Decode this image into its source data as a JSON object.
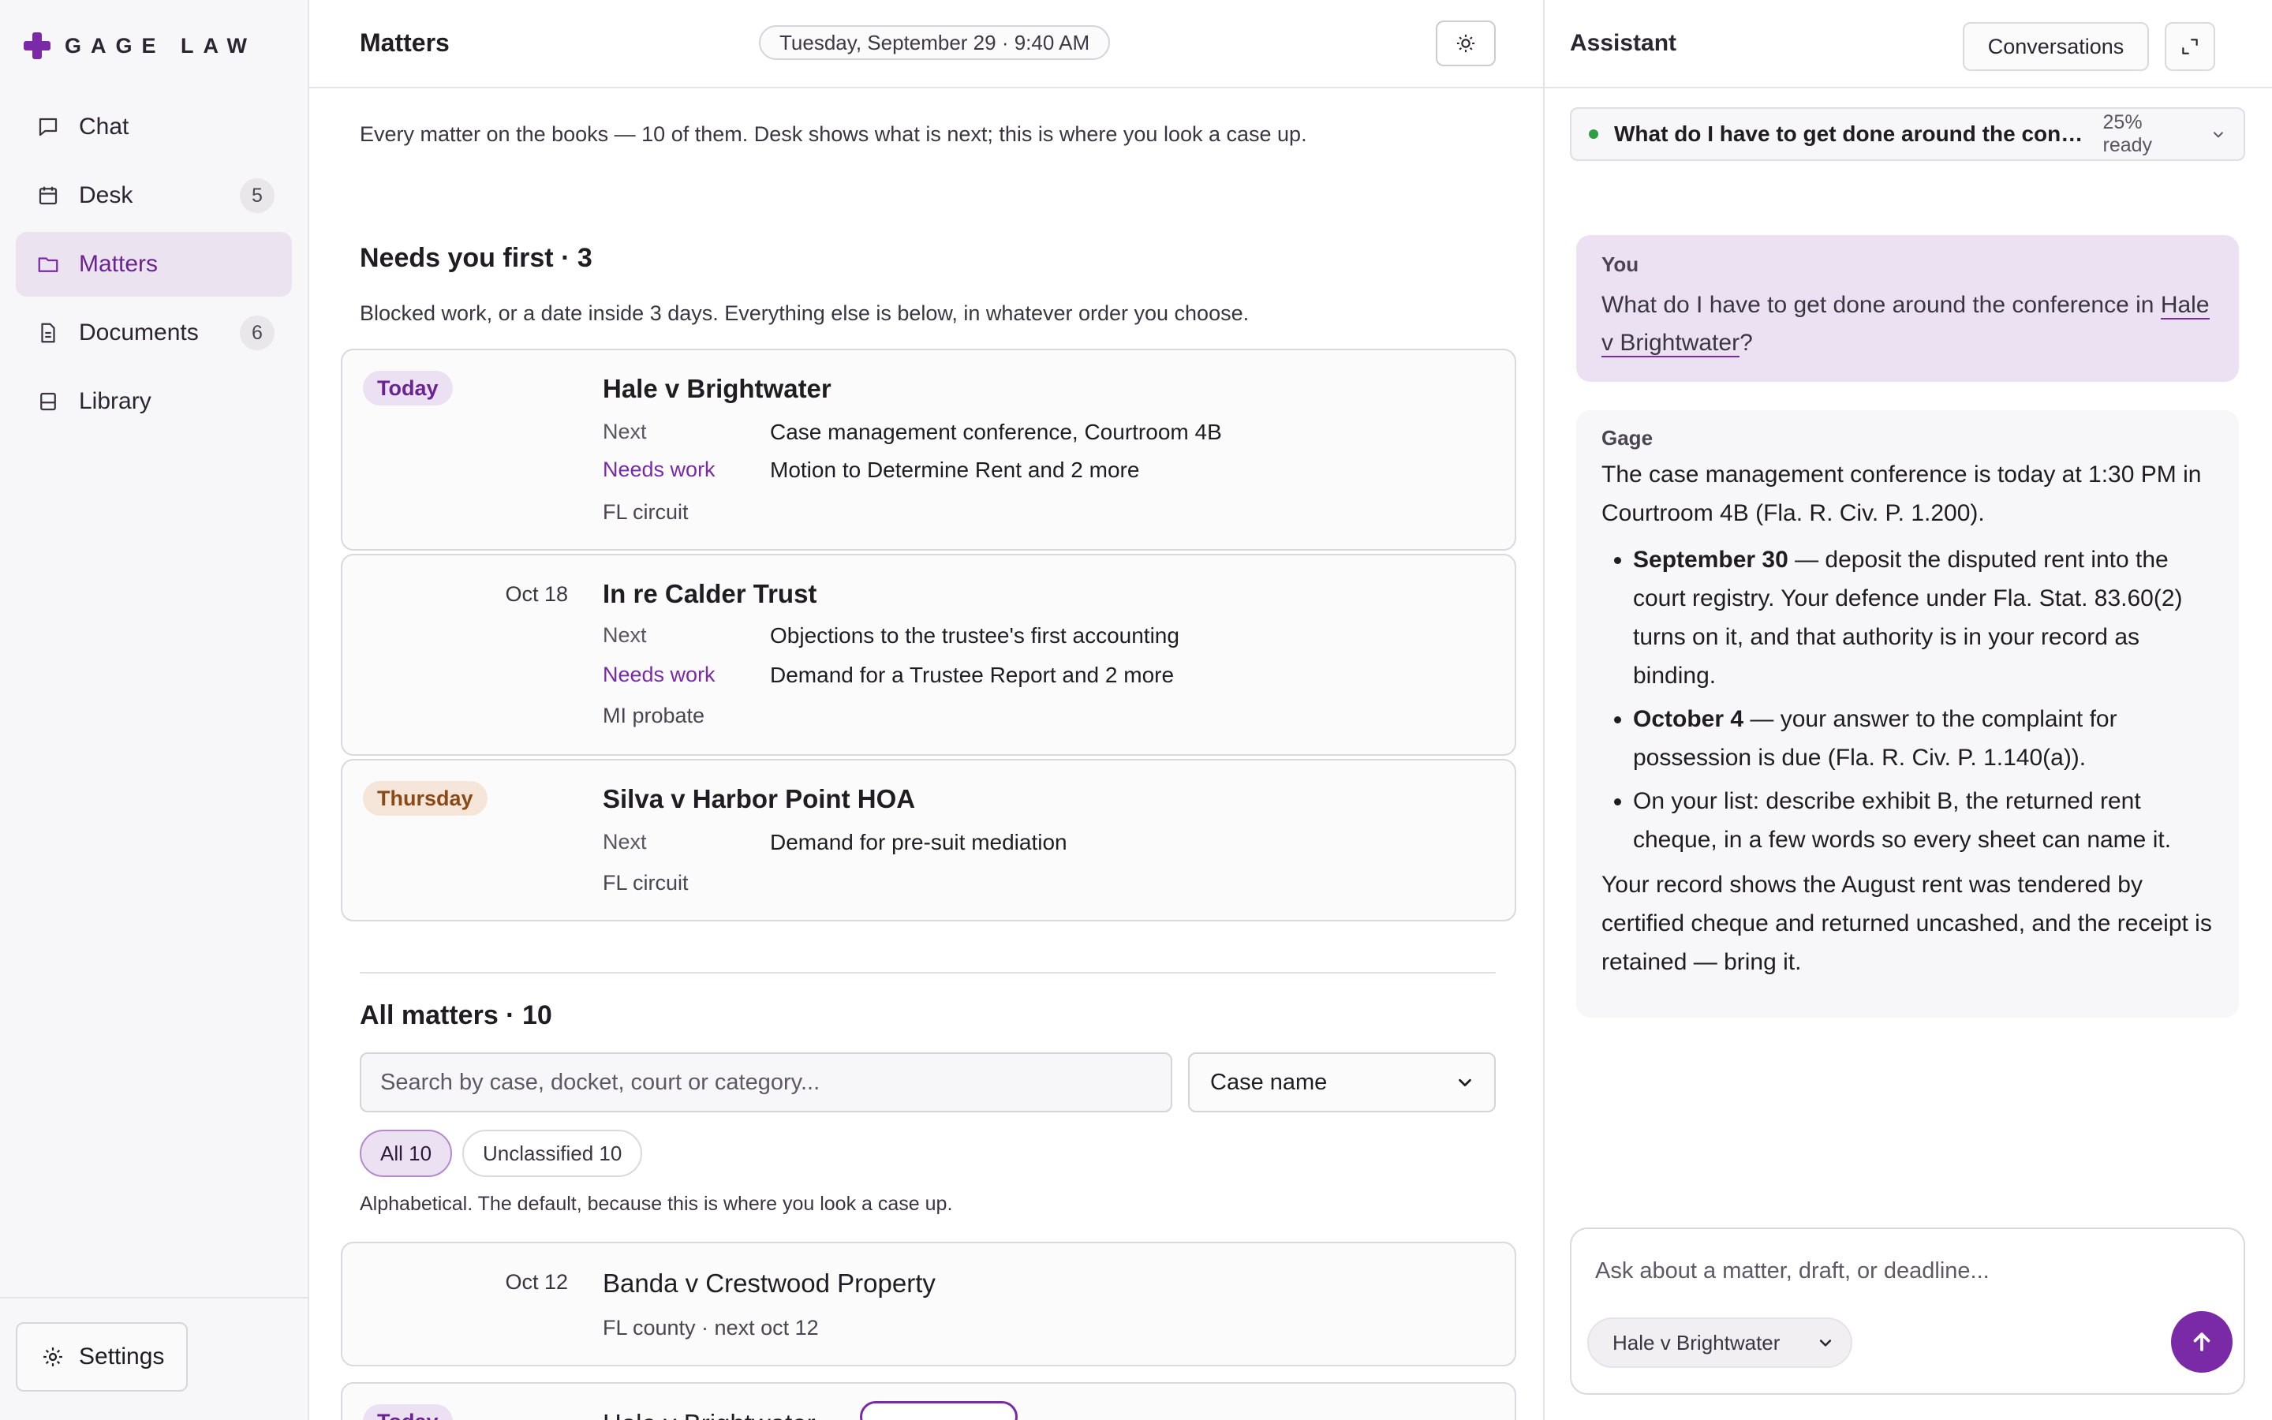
{
  "brand": {
    "name": "GAGE LAW"
  },
  "sidebar": {
    "items": [
      {
        "label": "Chat",
        "count": ""
      },
      {
        "label": "Desk",
        "count": "5"
      },
      {
        "label": "Matters",
        "count": ""
      },
      {
        "label": "Documents",
        "count": "6"
      },
      {
        "label": "Library",
        "count": ""
      }
    ],
    "settings_label": "Settings"
  },
  "header": {
    "title": "Matters",
    "datetime": "Tuesday, September 29 · 9:40 AM"
  },
  "intro": "Every matter on the books — 10 of them. Desk shows what is next; this is where you look a case up.",
  "needs_first": {
    "heading": "Needs you first · 3",
    "subtitle": "Blocked work, or a date inside 3 days. Everything else is below, in whatever order you choose.",
    "cards": [
      {
        "badge": "Today",
        "title": "Hale v Brightwater",
        "next_key": "Next",
        "next_value": "Case management conference, Courtroom 4B",
        "work_key": "Needs work",
        "work_value": "Motion to Determine Rent and 2 more",
        "court": "FL circuit"
      },
      {
        "when": "Oct 18",
        "title": "In re Calder Trust",
        "next_key": "Next",
        "next_value": "Objections to the trustee's first accounting",
        "work_key": "Needs work",
        "work_value": "Demand for a Trustee Report and 2 more",
        "court": "MI probate"
      },
      {
        "badge": "Thursday",
        "title": "Silva v Harbor Point HOA",
        "next_key": "Next",
        "next_value": "Demand for pre-suit mediation",
        "court": "FL circuit"
      }
    ]
  },
  "all_matters": {
    "heading": "All matters · 10",
    "search_placeholder": "Search by case, docket, court or category...",
    "sort_value": "Case name",
    "chips": [
      "All 10",
      "Unclassified 10"
    ],
    "helper": "Alphabetical. The default, because this is where you look a case up.",
    "rows": [
      {
        "when": "Oct 12",
        "title": "Banda v Crestwood Property",
        "meta": "FL county · next oct 12"
      },
      {
        "badge": "Today",
        "title": "Hale v Brightwater"
      }
    ]
  },
  "assistant": {
    "title": "Assistant",
    "conversations_label": "Conversations",
    "current_conversation": "What do I have to get done around the conference in Hale v Brightwater?",
    "ready": "25% ready",
    "you_label": "You",
    "you_text_before": "What do I have to get done around the conference in ",
    "you_link": "Hale v Brightwater",
    "you_text_after": "?",
    "gage_label": "Gage",
    "gage_intro": "The case management conference is today at 1:30 PM in Courtroom 4B (Fla. R. Civ. P. 1.200).",
    "gage_bullets": [
      {
        "bold": "September 30",
        "text": " — deposit the disputed rent into the court registry. Your defence under Fla. Stat. 83.60(2) turns on it, and that authority is in your record as binding."
      },
      {
        "bold": "October 4",
        "text": " — your answer to the complaint for possession is due (Fla. R. Civ. P. 1.140(a))."
      },
      {
        "bold": "",
        "text": "On your list: describe exhibit B, the returned rent cheque, in a few words so every sheet can name it."
      }
    ],
    "gage_outro": "Your record shows the August rent was tendered by certified cheque and returned uncashed, and the receipt is retained — bring it.",
    "composer_placeholder": "Ask about a matter, draft, or deadline...",
    "matter_select": "Hale v Brightwater"
  },
  "colors": {
    "accent": "#7a2aa6",
    "active_bg": "#ece3f1",
    "thursday_bg": "#f6e5d9"
  }
}
